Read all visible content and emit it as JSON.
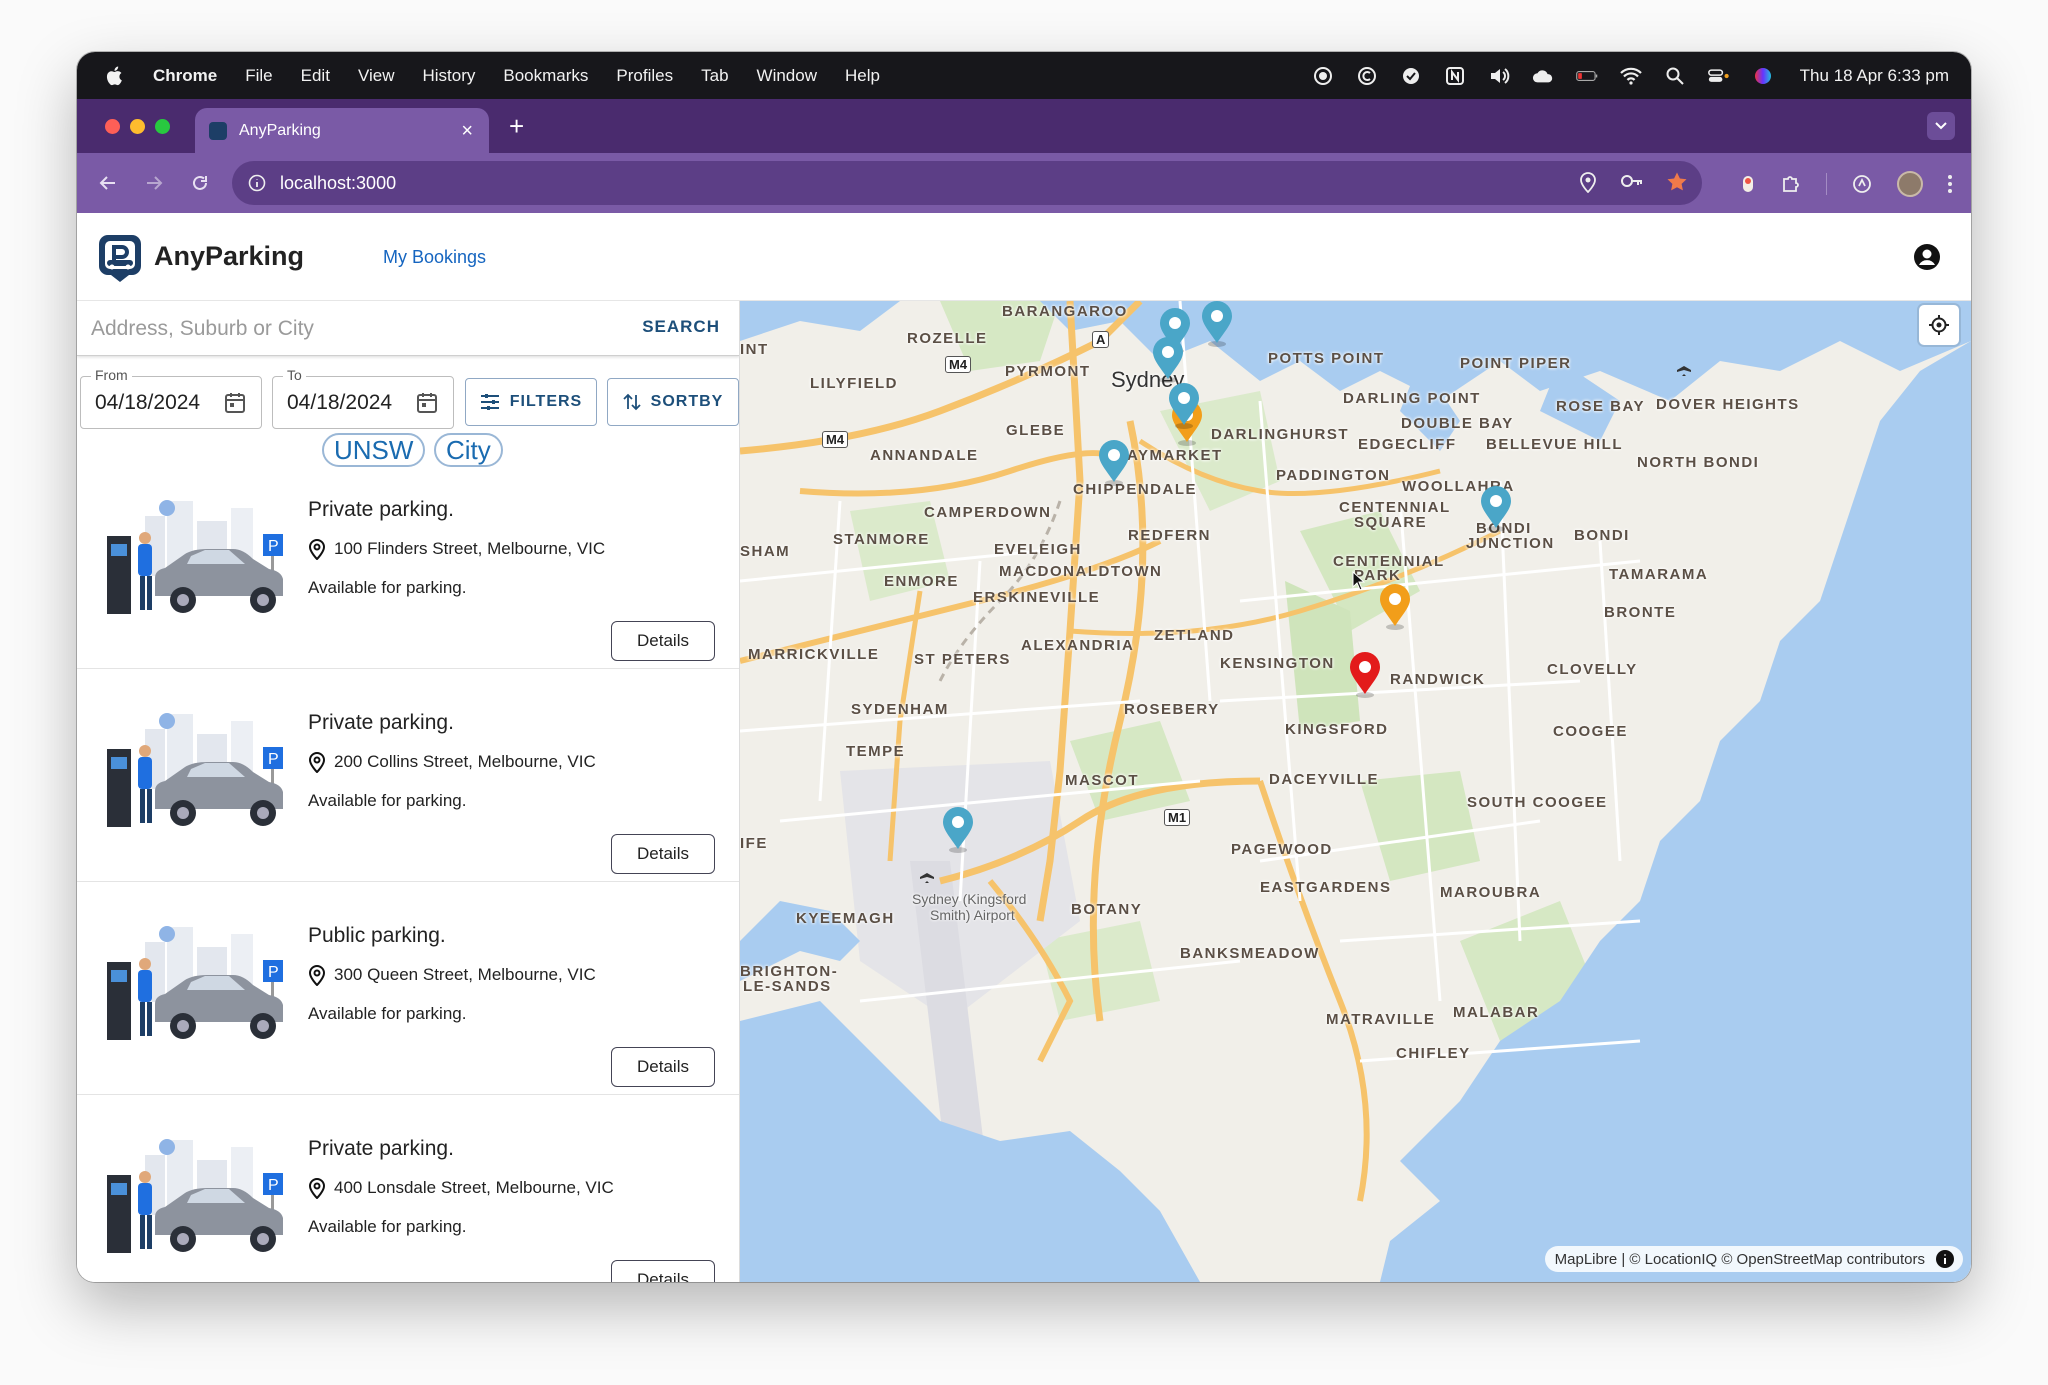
{
  "menubar": {
    "app": "Chrome",
    "items": [
      "File",
      "Edit",
      "View",
      "History",
      "Bookmarks",
      "Profiles",
      "Tab",
      "Window",
      "Help"
    ],
    "clock": "Thu 18 Apr  6:33 pm"
  },
  "browser": {
    "tab_title": "AnyParking",
    "tab_close": "×",
    "new_tab": "+",
    "url": "localhost:3000"
  },
  "app": {
    "brand": "AnyParking",
    "nav_link": "My Bookings"
  },
  "search": {
    "placeholder": "Address, Suburb or City",
    "button": "SEARCH"
  },
  "dates": {
    "from_label": "From",
    "from_value": "04/18/2024",
    "to_label": "To",
    "to_value": "04/18/2024"
  },
  "buttons": {
    "filters": "FILTERS",
    "sortby": "SORTBY"
  },
  "chips": [
    "UNSW",
    "City"
  ],
  "listings": [
    {
      "title": "Private parking.",
      "address": "100 Flinders Street, Melbourne, VIC",
      "status": "Available for parking.",
      "action": "Details"
    },
    {
      "title": "Private parking.",
      "address": "200 Collins Street, Melbourne, VIC",
      "status": "Available for parking.",
      "action": "Details"
    },
    {
      "title": "Public parking.",
      "address": "300 Queen Street, Melbourne, VIC",
      "status": "Available for parking.",
      "action": "Details"
    },
    {
      "title": "Private parking.",
      "address": "400 Lonsdale Street, Melbourne, VIC",
      "status": "Available for parking.",
      "action": "Details"
    }
  ],
  "map": {
    "labels": {
      "barangaroo": "BARANGAROO",
      "rozelle": "ROZELLE",
      "int": "INT",
      "pyrmont": "PYRMONT",
      "lilyfield": "LILYFIELD",
      "sydney": "Sydney",
      "potts_point": "POTTS POINT",
      "point_piper": "POINT PIPER",
      "darling_point": "DARLING POINT",
      "rose_bay": "ROSE BAY",
      "dover_heights": "DOVER HEIGHTS",
      "glebe": "GLEBE",
      "darlinghurst": "DARLINGHURST",
      "double_bay": "DOUBLE BAY",
      "edgecliff": "EDGECLIFF",
      "bellevue_hill": "BELLEVUE HILL",
      "annandale": "ANNANDALE",
      "haymarket": "AYMARKET",
      "north_bondi": "NORTH BONDI",
      "chippendale": "CHIPPENDALE",
      "paddington": "PADDINGTON",
      "woollahra": "WOOLLAHRA",
      "camperdown": "CAMPERDOWN",
      "centennial_square_1": "CENTENNIAL",
      "centennial_square_2": "SQUARE",
      "bondi_junction_1": "BONDI",
      "bondi_junction_2": "JUNCTION",
      "bondi": "BONDI",
      "sham": "SHAM",
      "stanmore": "STANMORE",
      "eveleigh": "EVELEIGH",
      "redfern": "REDFERN",
      "centennial_park_1": "CENTENNIAL",
      "centennial_park_2": "PARK",
      "tamarama": "TAMARAMA",
      "enmore": "ENMORE",
      "macdonaldtown": "MACDONALDTOWN",
      "erskineville": "ERSKINEVILLE",
      "bronte": "BRONTE",
      "zetland": "ZETLAND",
      "alexandria": "ALEXANDRIA",
      "marrickville": "MARRICKVILLE",
      "st_peters": "ST PETERS",
      "kensington": "KENSINGTON",
      "randwick": "RANDWICK",
      "clovelly": "CLOVELLY",
      "sydenham": "SYDENHAM",
      "rosebery": "ROSEBERY",
      "kingsford": "KINGSFORD",
      "coogee": "COOGEE",
      "tempe": "TEMPE",
      "mascot": "MASCOT",
      "daceyville": "DACEYVILLE",
      "south_coogee": "SOUTH COOGEE",
      "ife": "IFE",
      "pagewood": "PAGEWOOD",
      "eastgardens": "EASTGARDENS",
      "maroubra": "MAROUBRA",
      "airport_1": "Sydney (Kingsford",
      "airport_2": "Smith) Airport",
      "kyeemagh": "KYEEMAGH",
      "botany": "BOTANY",
      "banksmeadow": "BANKSMEADOW",
      "brighton_1": "BRIGHTON-",
      "brighton_2": "LE-SANDS",
      "matraville": "MATRAVILLE",
      "malabar": "MALABAR",
      "chifley": "CHIFLEY"
    },
    "shields": {
      "m4_top": "M4",
      "m4_left": "M4",
      "m1": "M1",
      "a": "A"
    },
    "attribution": "MapLibre | © LocationIQ © OpenStreetMap contributors",
    "colors": {
      "water": "#a9ccf0",
      "land": "#f1efe9",
      "park": "#d6e8c4",
      "road_major": "#f6c36b",
      "pin_blue": "#4aa6c8",
      "pin_orange": "#f29e1a",
      "pin_red": "#e31b1b"
    }
  },
  "colors": {
    "tab_bg": "#4a2b6e",
    "toolbar_bg": "#7a5aa6",
    "accent": "#1d4f7a",
    "link": "#1565c0"
  }
}
